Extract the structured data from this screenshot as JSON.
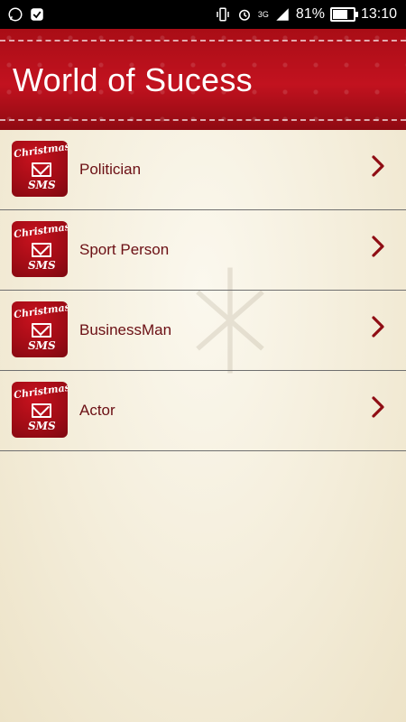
{
  "status_bar": {
    "battery_percent": "81%",
    "time": "13:10",
    "network_label": "3G",
    "battery_level": 0.81
  },
  "header": {
    "title": "World of Sucess"
  },
  "list": {
    "items": [
      {
        "label": "Politician",
        "icon": "christmas-sms-icon"
      },
      {
        "label": "Sport Person",
        "icon": "christmas-sms-icon"
      },
      {
        "label": "BusinessMan",
        "icon": "christmas-sms-icon"
      },
      {
        "label": "Actor",
        "icon": "christmas-sms-icon"
      }
    ],
    "chevron_icon": "chevron-right-icon",
    "thumb_script_text": "Christmas",
    "thumb_sms_text": "SMS"
  },
  "colors": {
    "header_red": "#b50f1a",
    "label_text": "#6b0f14",
    "chevron": "#8f0d14"
  }
}
